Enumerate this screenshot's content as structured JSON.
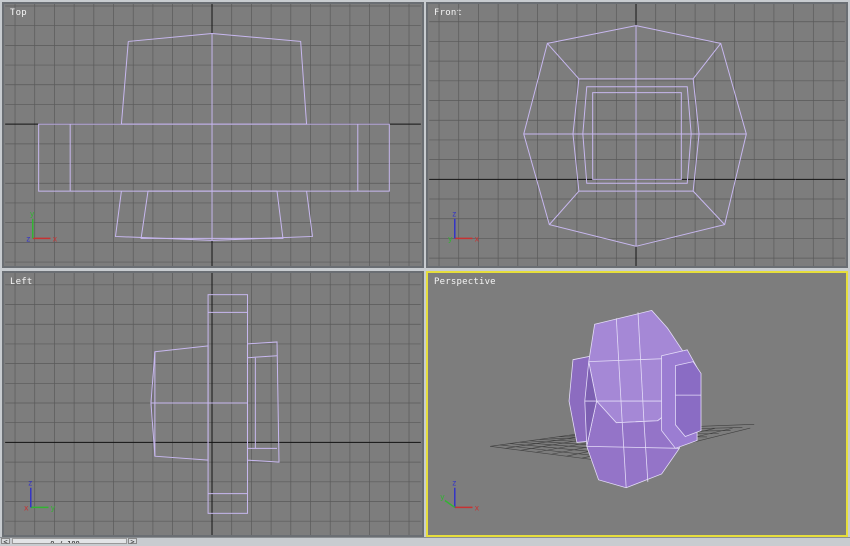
{
  "viewports": {
    "top": {
      "label": "Top",
      "active": false
    },
    "front": {
      "label": "Front",
      "active": false
    },
    "left": {
      "label": "Left",
      "active": false
    },
    "perspective": {
      "label": "Perspective",
      "active": true
    }
  },
  "colors": {
    "grid": "#5a5a5a",
    "axis": "#141414",
    "wire": "#c8b8f0",
    "active_border": "#e6de3c",
    "mesh_face": "#9d7fd0",
    "axis_x": "#c83232",
    "axis_y": "#32b432",
    "axis_z": "#3232c8"
  },
  "axis_labels": {
    "x": "x",
    "y": "y",
    "z": "z"
  },
  "timeline": {
    "current": "0",
    "total": "100",
    "separator": "/",
    "prev_arrow": "<",
    "next_arrow": ">"
  }
}
